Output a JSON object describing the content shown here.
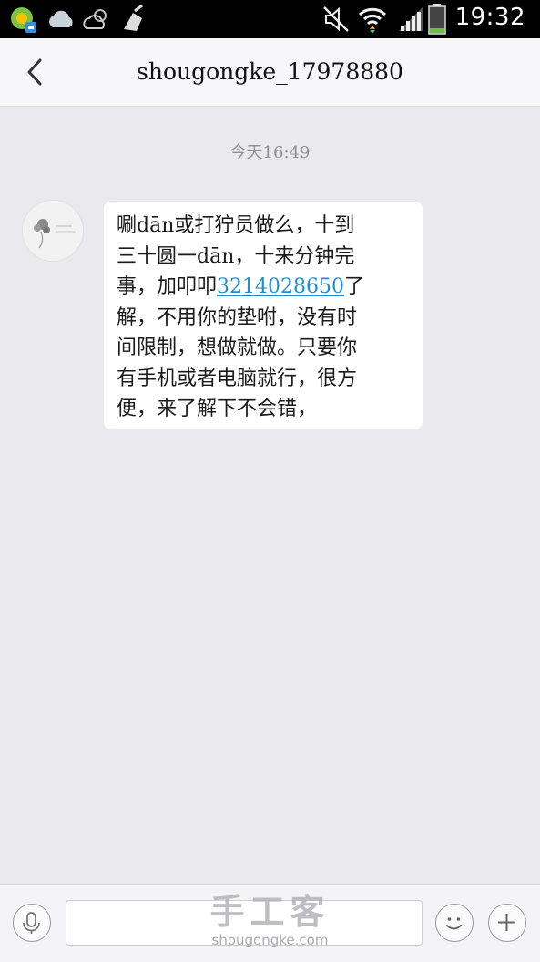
{
  "status_bar": {
    "time": "19:32",
    "icons": [
      "app-notification-icon",
      "cloud-icon",
      "weather-icon",
      "cleaner-icon",
      "mute-icon",
      "wifi-icon",
      "signal-icon",
      "battery-icon"
    ]
  },
  "header": {
    "back_icon": "chevron-left-icon",
    "title": "shougongke_17978880"
  },
  "chat": {
    "timestamp": "今天16:49",
    "message": {
      "line1": "唰dān或打狞员做么，十到",
      "line2": "三十圆一dān，十来分钟完",
      "line3_pre": "事，加叩叩",
      "phone": "3214028650",
      "line3_post": "了",
      "line4": "解，不用你的垫咐，没有时",
      "line5": "间限制，想做就做。只要你",
      "line6": "有手机或者电脑就行，很方",
      "line7": "便，来了解下不会错，"
    }
  },
  "input_bar": {
    "voice_icon": "microphone-icon",
    "emoji_icon": "smiley-icon",
    "plus_icon": "plus-icon",
    "text_value": ""
  },
  "watermark": {
    "main": "手工客",
    "sub": "shougongke.com"
  },
  "colors": {
    "link": "#1f8ed8",
    "chat_background": "#e9e9ee"
  }
}
